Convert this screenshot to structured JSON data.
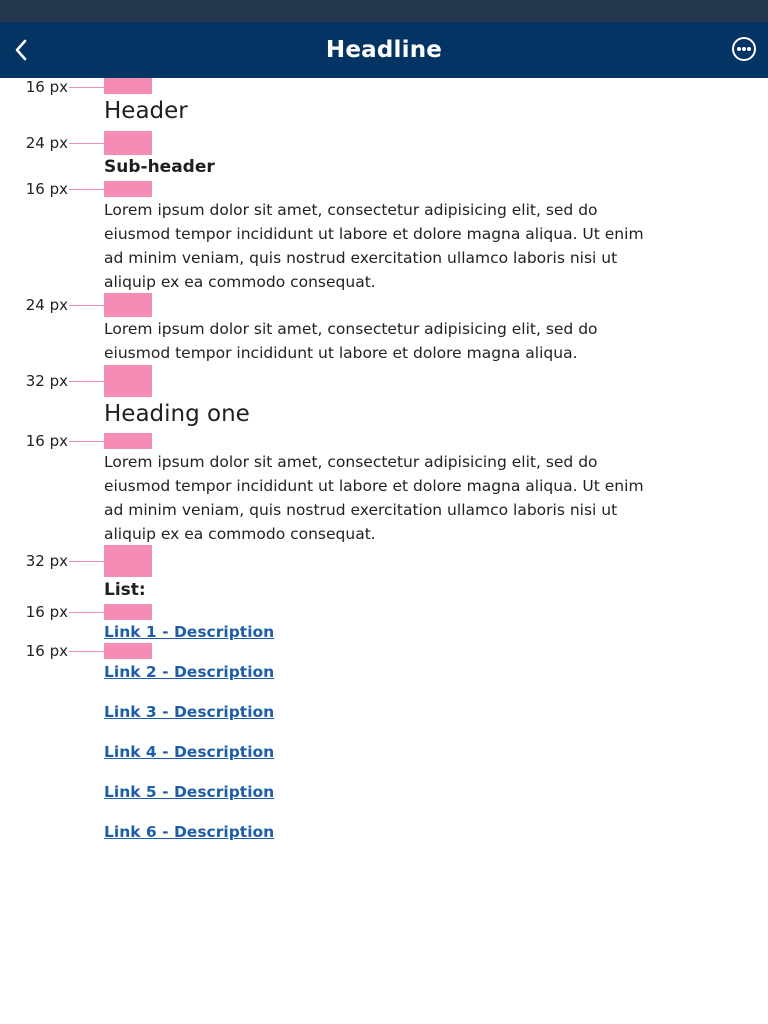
{
  "nav": {
    "title": "Headline",
    "back_icon": "chevron-left-icon",
    "more_icon": "more-horizontal-icon"
  },
  "spacing_labels": [
    "16 px",
    "24 px",
    "16 px",
    "24 px",
    "32 px",
    "16 px",
    "32 px",
    "16 px",
    "16 px"
  ],
  "content": {
    "header": "Header",
    "subheader": "Sub-header",
    "paragraph1": "Lorem ipsum dolor sit amet, consectetur adipisicing elit, sed do eiusmod tempor incididunt ut labore et dolore magna aliqua. Ut enim ad minim veniam, quis nostrud exercitation ullamco laboris nisi ut aliquip ex ea commodo consequat.",
    "paragraph2": "Lorem ipsum dolor sit amet, consectetur adipisicing elit, sed do eiusmod tempor incididunt ut labore et dolore magna aliqua.",
    "heading_one": "Heading one",
    "paragraph3": "Lorem ipsum dolor sit amet, consectetur adipisicing elit, sed do eiusmod tempor incididunt ut labore et dolore magna aliqua. Ut enim ad minim veniam, quis nostrud exercitation ullamco laboris nisi ut aliquip ex ea commodo consequat.",
    "list_label": "List:"
  },
  "links": [
    "Link 1 - Description",
    "Link 2 - Description",
    "Link 3 - Description",
    "Link 4 - Description",
    "Link 5 - Description",
    "Link 6 - Description"
  ],
  "colors": {
    "status_bar": "#25374f",
    "nav_bar": "#043463",
    "spacer": "#f48cb6",
    "link": "#1d5ea8"
  }
}
